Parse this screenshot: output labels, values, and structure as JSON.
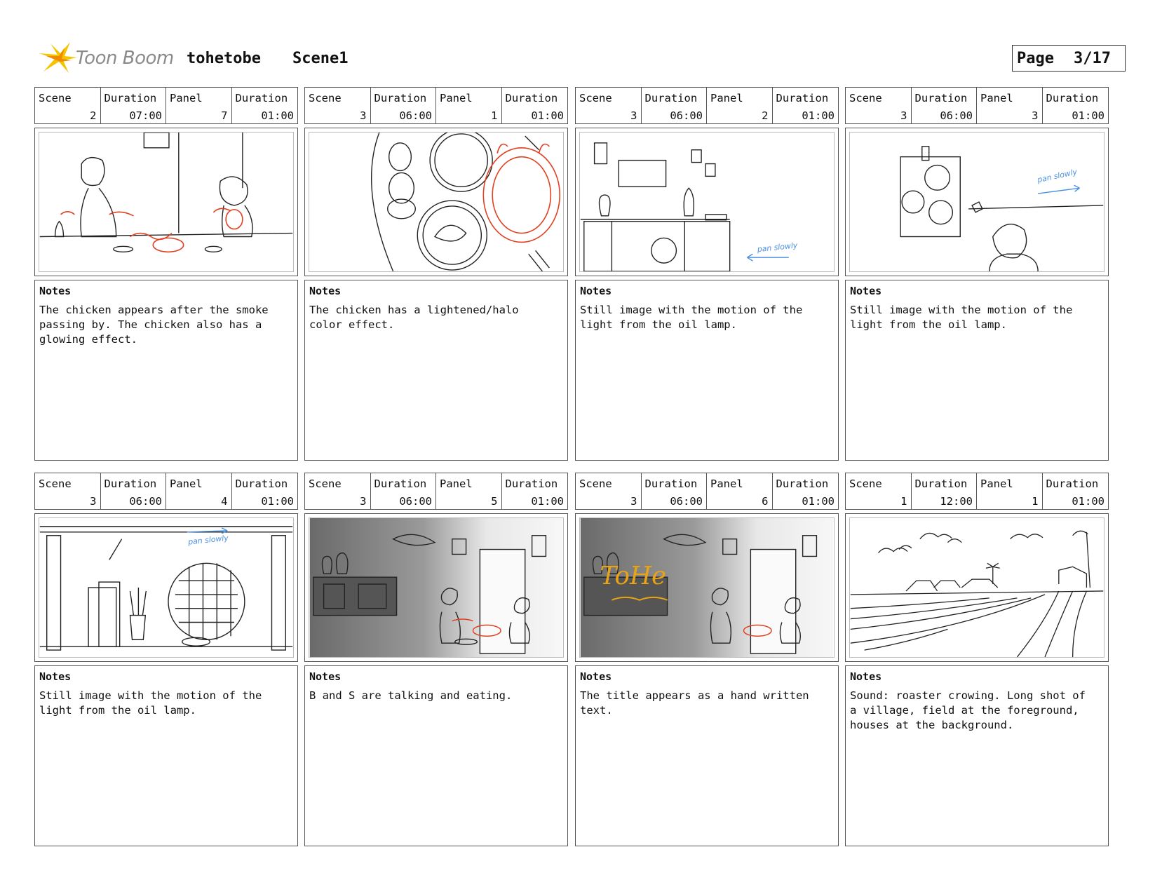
{
  "header": {
    "logo_text": "Toon Boom",
    "project": "tohetobe",
    "scene": "Scene1",
    "page_label": "Page",
    "page_value": "3/17"
  },
  "labels": {
    "scene": "Scene",
    "duration": "Duration",
    "panel": "Panel",
    "notes": "Notes"
  },
  "panels": [
    {
      "scene": "2",
      "scene_duration": "07:00",
      "panel": "7",
      "panel_duration": "01:00",
      "notes": "The chicken appears after the smoke\npassing by. The chicken also has a\nglowing effect."
    },
    {
      "scene": "3",
      "scene_duration": "06:00",
      "panel": "1",
      "panel_duration": "01:00",
      "notes": "The chicken has a lightened/halo\ncolor effect."
    },
    {
      "scene": "3",
      "scene_duration": "06:00",
      "panel": "2",
      "panel_duration": "01:00",
      "notes": "Still image with the motion of the\nlight from the oil lamp.",
      "annotation": "pan slowly"
    },
    {
      "scene": "3",
      "scene_duration": "06:00",
      "panel": "3",
      "panel_duration": "01:00",
      "notes": "Still image with the motion of the\nlight from the oil lamp.",
      "annotation": "pan slowly"
    },
    {
      "scene": "3",
      "scene_duration": "06:00",
      "panel": "4",
      "panel_duration": "01:00",
      "notes": "Still image with the motion of the\nlight from the oil lamp.",
      "annotation": "pan slowly"
    },
    {
      "scene": "3",
      "scene_duration": "06:00",
      "panel": "5",
      "panel_duration": "01:00",
      "notes": "B and S are talking and eating."
    },
    {
      "scene": "3",
      "scene_duration": "06:00",
      "panel": "6",
      "panel_duration": "01:00",
      "notes": "The title appears as a hand written\ntext.",
      "annotation": "ToHe"
    },
    {
      "scene": "1",
      "scene_duration": "12:00",
      "panel": "1",
      "panel_duration": "01:00",
      "notes": "Sound: roaster crowing. Long shot of\na village, field at the foreground,\nhouses at the background."
    }
  ],
  "colors": {
    "sketch": "#222222",
    "highlight": "#e04020",
    "annotation": "#4a90e2",
    "title_handwriting": "#e8a317",
    "logo_star": "#f5c400"
  }
}
